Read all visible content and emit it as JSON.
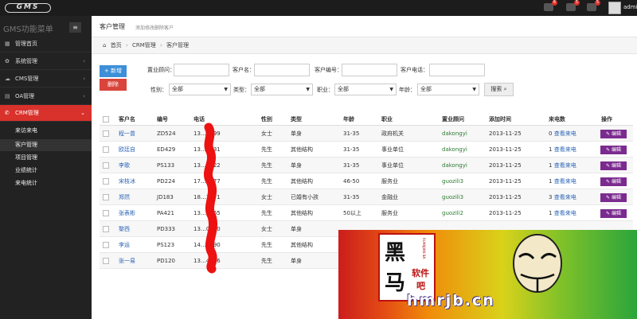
{
  "header": {
    "logo": "GMS",
    "notifications": [
      {
        "name": "bell",
        "count": "6"
      },
      {
        "name": "mail",
        "count": "5"
      },
      {
        "name": "tasks",
        "count": "5"
      }
    ],
    "user": "admin"
  },
  "sidebar": {
    "title": "GMS功能菜单",
    "toggle_icon": "≡",
    "items": [
      {
        "label": "管理首页",
        "icon": "dashboard-icon"
      },
      {
        "label": "系统管理",
        "icon": "gear-icon"
      },
      {
        "label": "CMS管理",
        "icon": "cloud-icon"
      },
      {
        "label": "OA管理",
        "icon": "building-icon"
      },
      {
        "label": "CRM管理",
        "icon": "phone-icon"
      }
    ],
    "sub_items": [
      "来访来电",
      "客户管理",
      "项目管理",
      "业绩统计",
      "来电统计"
    ]
  },
  "page": {
    "title": "客户管理",
    "subtitle": "添加修改删除客户",
    "breadcrumb": [
      "首页",
      "CRM管理",
      "客户管理"
    ]
  },
  "toolbar": {
    "new_label": "+ 新增",
    "delete_label": "删除"
  },
  "filters": {
    "consultant": "置业顾问：",
    "name": "客户名：",
    "code": "客户编号：",
    "phone": "客户电话：",
    "gender": "性别：",
    "type": "类型：",
    "job": "职业：",
    "age": "年龄：",
    "all": "全部",
    "search": "搜索"
  },
  "table": {
    "headers": [
      "客户名",
      "编号",
      "电话",
      "性别",
      "类型",
      "年龄",
      "职业",
      "置业顾问",
      "添加时间",
      "来电数",
      "操作"
    ],
    "rows": [
      {
        "name": "程一曾",
        "code": "ZD524",
        "phone": "13…0999",
        "gender": "女士",
        "type": "单身",
        "age": "31-35",
        "job": "政府机关",
        "consultant": "dakongyi",
        "date": "2013-11-25",
        "calls": "0",
        "view": "查看来电",
        "edit": "编辑"
      },
      {
        "name": "欧廷自",
        "code": "ED429",
        "phone": "13…4531",
        "gender": "先生",
        "type": "其他结构",
        "age": "31-35",
        "job": "事业单位",
        "consultant": "dakongyi",
        "date": "2013-11-25",
        "calls": "1",
        "view": "查看来电",
        "edit": "编辑"
      },
      {
        "name": "李歌",
        "code": "PS133",
        "phone": "13…9822",
        "gender": "先生",
        "type": "单身",
        "age": "31-35",
        "job": "事业单位",
        "consultant": "dakongyi",
        "date": "2013-11-25",
        "calls": "1",
        "view": "查看来电",
        "edit": "编辑"
      },
      {
        "name": "宋枝冰",
        "code": "PD224",
        "phone": "17…8777",
        "gender": "先生",
        "type": "其他结构",
        "age": "46-50",
        "job": "服务业",
        "consultant": "guozili3",
        "date": "2013-11-25",
        "calls": "1",
        "view": "查看来电",
        "edit": "编辑"
      },
      {
        "name": "郑然",
        "code": "JD183",
        "phone": "18…1571",
        "gender": "女士",
        "type": "已婚有小孩",
        "age": "31-35",
        "job": "金融业",
        "consultant": "guozili3",
        "date": "2013-11-25",
        "calls": "3",
        "view": "查看来电",
        "edit": "编辑"
      },
      {
        "name": "张表彬",
        "code": "PA421",
        "phone": "13…4765",
        "gender": "先生",
        "type": "其他结构",
        "age": "50以上",
        "job": "服务业",
        "consultant": "guozili2",
        "date": "2013-11-25",
        "calls": "1",
        "view": "查看来电",
        "edit": "编辑"
      },
      {
        "name": "黎西",
        "code": "PD333",
        "phone": "13…0000",
        "gender": "女士",
        "type": "单身",
        "age": "",
        "job": "",
        "consultant": "",
        "date": "",
        "calls": "",
        "view": "",
        "edit": ""
      },
      {
        "name": "李运",
        "code": "PS123",
        "phone": "14…2890",
        "gender": "先生",
        "type": "其他结构",
        "age": "",
        "job": "",
        "consultant": "",
        "date": "",
        "calls": "",
        "view": "",
        "edit": ""
      },
      {
        "name": "张一易",
        "code": "PD120",
        "phone": "13…4356",
        "gender": "先生",
        "type": "单身",
        "age": "",
        "job": "",
        "consultant": "",
        "date": "",
        "calls": "",
        "view": "",
        "edit": ""
      }
    ]
  },
  "watermark": {
    "logo_char_top": "黑",
    "logo_char_bottom": "马",
    "logo_side_a": "软件",
    "logo_side_b": "吧",
    "logo_vertical": "RUANJIAN BA",
    "site": "hmrjb.cn"
  },
  "colors": {
    "accent": "#d9312b",
    "link": "#2a63b6",
    "edit_button": "#7b2b8f",
    "new_button": "#3d8fd8",
    "delete_button": "#d9443b"
  }
}
